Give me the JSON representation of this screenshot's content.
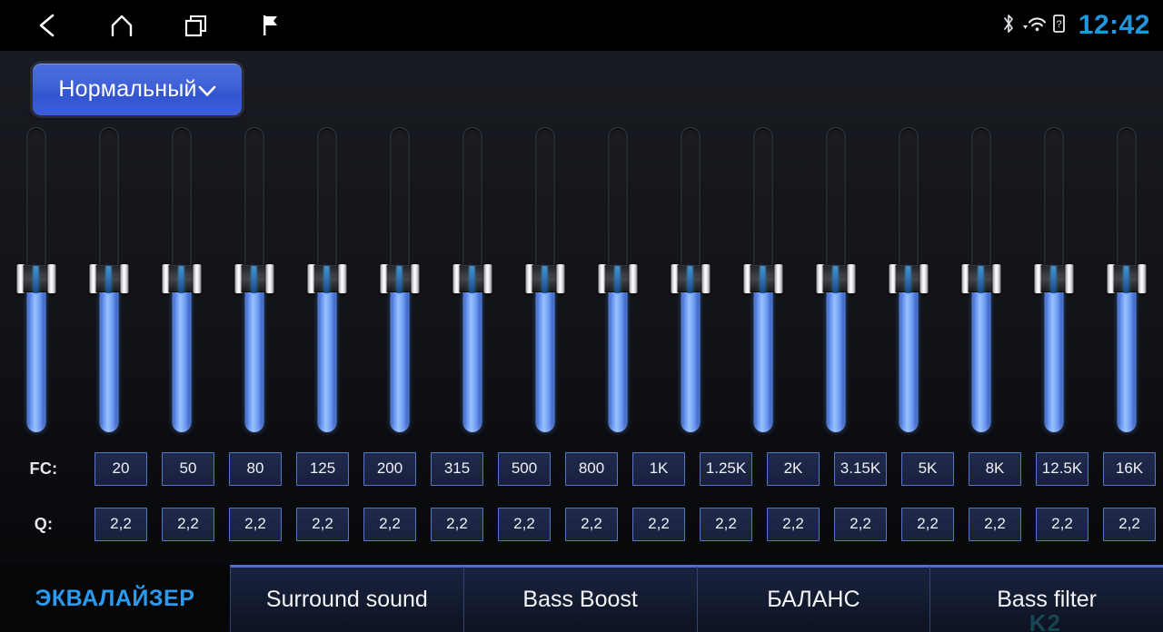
{
  "statusbar": {
    "nav": [
      {
        "name": "back-icon",
        "label": "Back"
      },
      {
        "name": "home-icon",
        "label": "Home"
      },
      {
        "name": "recents-icon",
        "label": "Recent apps"
      },
      {
        "name": "flag-icon",
        "label": "Navigation"
      }
    ],
    "icons": [
      {
        "name": "bluetooth-icon",
        "label": "Bluetooth"
      },
      {
        "name": "wifi-icon",
        "label": "Wi-Fi"
      },
      {
        "name": "sim-card-icon",
        "label": "SIM card"
      }
    ],
    "time": "12:42",
    "time_color": "#2196dd"
  },
  "preset": {
    "label": "Нормальный",
    "chevron": "⌄",
    "accent_color": "#4163d8"
  },
  "equalizer": {
    "fc_row_label": "FC:",
    "q_row_label": "Q:",
    "band_count": 16,
    "bands": [
      {
        "fc": "20",
        "q": "2,2",
        "level": 50
      },
      {
        "fc": "50",
        "q": "2,2",
        "level": 50
      },
      {
        "fc": "80",
        "q": "2,2",
        "level": 50
      },
      {
        "fc": "125",
        "q": "2,2",
        "level": 50
      },
      {
        "fc": "200",
        "q": "2,2",
        "level": 50
      },
      {
        "fc": "315",
        "q": "2,2",
        "level": 50
      },
      {
        "fc": "500",
        "q": "2,2",
        "level": 50
      },
      {
        "fc": "800",
        "q": "2,2",
        "level": 50
      },
      {
        "fc": "1K",
        "q": "2,2",
        "level": 50
      },
      {
        "fc": "1.25K",
        "q": "2,2",
        "level": 50
      },
      {
        "fc": "2K",
        "q": "2,2",
        "level": 50
      },
      {
        "fc": "3.15K",
        "q": "2,2",
        "level": 50
      },
      {
        "fc": "5K",
        "q": "2,2",
        "level": 50
      },
      {
        "fc": "8K",
        "q": "2,2",
        "level": 50
      },
      {
        "fc": "12.5K",
        "q": "2,2",
        "level": 50
      },
      {
        "fc": "16K",
        "q": "2,2",
        "level": 50
      }
    ],
    "slider_fill_color": "#6e9df3"
  },
  "tabs": [
    {
      "label": "ЭКВАЛАЙЗЕР",
      "active": true
    },
    {
      "label": "Surround sound",
      "active": false
    },
    {
      "label": "Bass Boost",
      "active": false
    },
    {
      "label": "БАЛАНС",
      "active": false
    },
    {
      "label": "Bass filter",
      "active": false
    }
  ],
  "watermark": "K2"
}
